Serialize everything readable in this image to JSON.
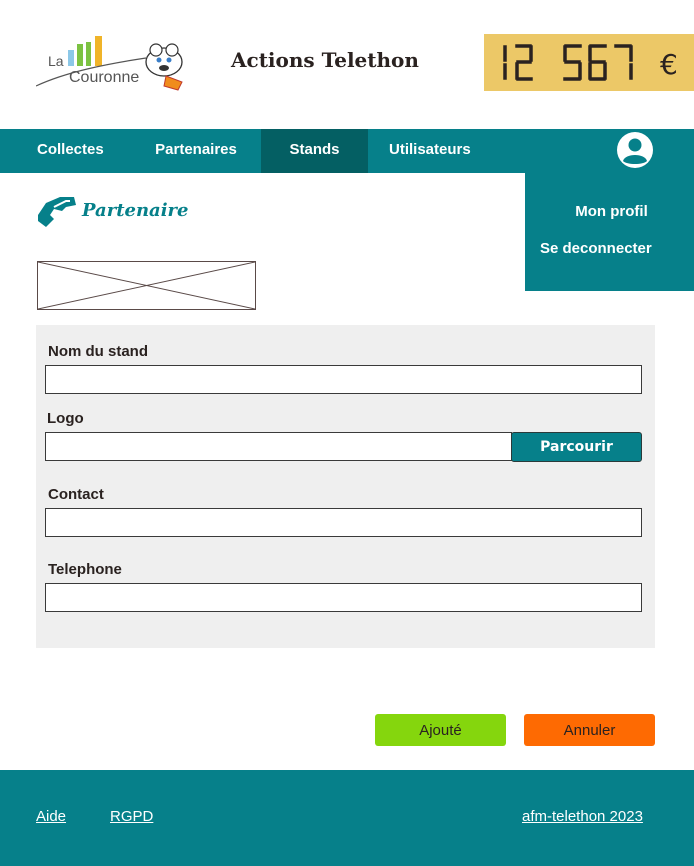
{
  "header": {
    "logo": {
      "line1": "La",
      "line2": "Couronne",
      "icon": "la-couronne-logo-with-mascot"
    },
    "title": "Actions Telethon",
    "counter": {
      "digits": [
        "1",
        "2",
        "5",
        "6",
        "7"
      ],
      "currency": "€",
      "text": "12 567 €",
      "background": "#ecc867"
    }
  },
  "nav": {
    "items": [
      {
        "label": "Collectes",
        "active": false
      },
      {
        "label": "Partenaires",
        "active": false
      },
      {
        "label": "Stands",
        "active": true
      },
      {
        "label": "Utilisateurs",
        "active": false
      }
    ],
    "user_icon": "user-account-icon"
  },
  "user_menu": {
    "items": [
      {
        "label": "Mon profil"
      },
      {
        "label": "Se deconnecter"
      }
    ]
  },
  "section": {
    "icon": "handshake-icon",
    "title": "Partenaire"
  },
  "form": {
    "fields": {
      "stand_name": {
        "label": "Nom du stand",
        "value": ""
      },
      "logo": {
        "label": "Logo",
        "value": ""
      },
      "contact": {
        "label": "Contact",
        "value": ""
      },
      "telephone": {
        "label": "Telephone",
        "value": ""
      }
    },
    "browse_label": "Parcourir"
  },
  "actions": {
    "submit_label": "Ajouté",
    "cancel_label": "Annuler"
  },
  "footer": {
    "links": [
      {
        "label": "Aide"
      },
      {
        "label": "RGPD"
      },
      {
        "label": "afm-telethon 2023"
      }
    ]
  },
  "colors": {
    "primary": "#06808a",
    "primary_dark": "#045f63",
    "counter_bg": "#ecc867",
    "add_button": "#85d60d",
    "cancel_button": "#fe6a02"
  }
}
